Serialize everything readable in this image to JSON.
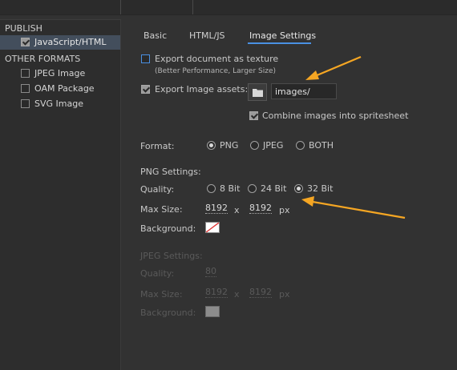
{
  "sidebar": {
    "publish_header": "PUBLISH",
    "other_formats_header": "OTHER FORMATS",
    "items": [
      {
        "label": "JavaScript/HTML",
        "checked": true,
        "selected": true
      },
      {
        "label": "JPEG Image",
        "checked": false,
        "selected": false
      },
      {
        "label": "OAM Package",
        "checked": false,
        "selected": false
      },
      {
        "label": "SVG Image",
        "checked": false,
        "selected": false
      }
    ]
  },
  "tabs": [
    {
      "label": "Basic",
      "active": false
    },
    {
      "label": "HTML/JS",
      "active": false
    },
    {
      "label": "Image Settings",
      "active": true
    }
  ],
  "export_texture": {
    "label": "Export document as texture",
    "note": "(Better Performance, Larger Size)",
    "checked": false
  },
  "export_assets": {
    "label": "Export Image assets:",
    "checked": true,
    "path": "images/",
    "folder_icon": "folder-icon"
  },
  "combine": {
    "label": "Combine images into spritesheet",
    "checked": true
  },
  "format": {
    "label": "Format:",
    "options": [
      "PNG",
      "JPEG",
      "BOTH"
    ],
    "selected": "PNG"
  },
  "png": {
    "header": "PNG Settings:",
    "quality_label": "Quality:",
    "quality_options": [
      "8 Bit",
      "24 Bit",
      "32 Bit"
    ],
    "quality_selected": "32 Bit",
    "maxsize_label": "Max Size:",
    "width": "8192",
    "x": "x",
    "height": "8192",
    "unit": "px",
    "background_label": "Background:"
  },
  "jpeg": {
    "header": "JPEG Settings:",
    "quality_label": "Quality:",
    "quality": "80",
    "maxsize_label": "Max Size:",
    "width": "8192",
    "x": "x",
    "height": "8192",
    "unit": "px",
    "background_label": "Background:"
  },
  "colors": {
    "accent": "#4a90e2",
    "arrow": "#f5a623"
  }
}
